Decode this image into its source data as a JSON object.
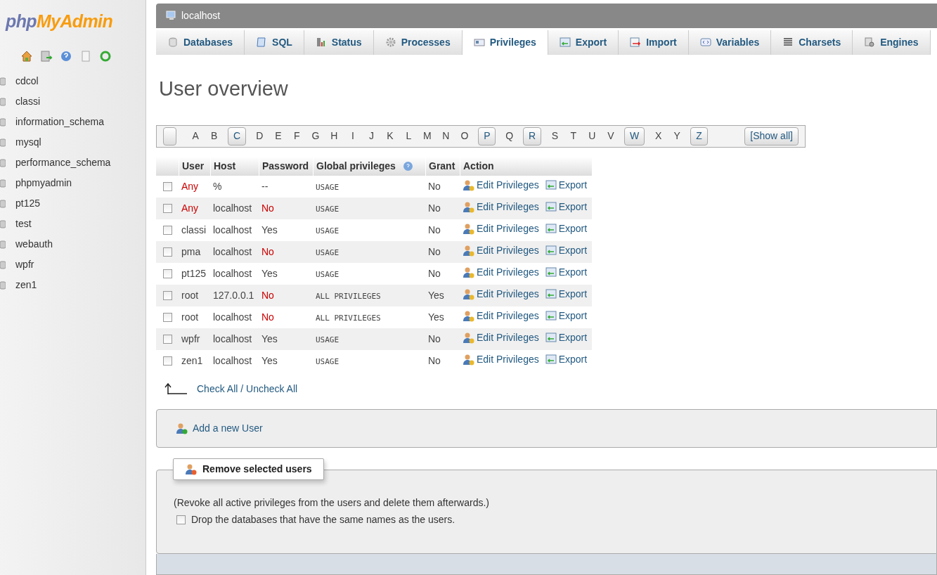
{
  "sidebar": {
    "logo_left": "php",
    "logo_right": "MyAdmin",
    "databases": [
      "cdcol",
      "classi",
      "information_schema",
      "mysql",
      "performance_schema",
      "phpmyadmin",
      "pt125",
      "test",
      "webauth",
      "wpfr",
      "zen1"
    ]
  },
  "server": {
    "title": "localhost"
  },
  "tabs": [
    {
      "label": "Databases",
      "selected": false
    },
    {
      "label": "SQL",
      "selected": false
    },
    {
      "label": "Status",
      "selected": false
    },
    {
      "label": "Processes",
      "selected": false
    },
    {
      "label": "Privileges",
      "selected": true
    },
    {
      "label": "Export",
      "selected": false
    },
    {
      "label": "Import",
      "selected": false
    },
    {
      "label": "Variables",
      "selected": false
    },
    {
      "label": "Charsets",
      "selected": false
    },
    {
      "label": "Engines",
      "selected": false
    }
  ],
  "heading": "User overview",
  "letters": [
    {
      "label": "A",
      "enabled": false
    },
    {
      "label": "B",
      "enabled": false
    },
    {
      "label": "C",
      "enabled": true
    },
    {
      "label": "D",
      "enabled": false
    },
    {
      "label": "E",
      "enabled": false
    },
    {
      "label": "F",
      "enabled": false
    },
    {
      "label": "G",
      "enabled": false
    },
    {
      "label": "H",
      "enabled": false
    },
    {
      "label": "I",
      "enabled": false
    },
    {
      "label": "J",
      "enabled": false
    },
    {
      "label": "K",
      "enabled": false
    },
    {
      "label": "L",
      "enabled": false
    },
    {
      "label": "M",
      "enabled": false
    },
    {
      "label": "N",
      "enabled": false
    },
    {
      "label": "O",
      "enabled": false
    },
    {
      "label": "P",
      "enabled": true
    },
    {
      "label": "Q",
      "enabled": false
    },
    {
      "label": "R",
      "enabled": true
    },
    {
      "label": "S",
      "enabled": false
    },
    {
      "label": "T",
      "enabled": false
    },
    {
      "label": "U",
      "enabled": false
    },
    {
      "label": "V",
      "enabled": false
    },
    {
      "label": "W",
      "enabled": true
    },
    {
      "label": "X",
      "enabled": false
    },
    {
      "label": "Y",
      "enabled": false
    },
    {
      "label": "Z",
      "enabled": true
    }
  ],
  "show_all": "[Show all]",
  "table": {
    "columns": [
      "User",
      "Host",
      "Password",
      "Global privileges",
      "Grant",
      "Action"
    ],
    "rows": [
      {
        "user": "Any",
        "anonymous": true,
        "host": "%",
        "password": "--",
        "password_warning": false,
        "privileges": "USAGE",
        "grant": "No",
        "checked": false,
        "edit": "Edit Privileges",
        "export": "Export"
      },
      {
        "user": "Any",
        "anonymous": true,
        "host": "localhost",
        "password": "No",
        "password_warning": true,
        "privileges": "USAGE",
        "grant": "No",
        "checked": false,
        "edit": "Edit Privileges",
        "export": "Export"
      },
      {
        "user": "classi",
        "anonymous": false,
        "host": "localhost",
        "password": "Yes",
        "password_warning": false,
        "privileges": "USAGE",
        "grant": "No",
        "checked": false,
        "edit": "Edit Privileges",
        "export": "Export"
      },
      {
        "user": "pma",
        "anonymous": false,
        "host": "localhost",
        "password": "No",
        "password_warning": true,
        "privileges": "USAGE",
        "grant": "No",
        "checked": false,
        "edit": "Edit Privileges",
        "export": "Export"
      },
      {
        "user": "pt125",
        "anonymous": false,
        "host": "localhost",
        "password": "Yes",
        "password_warning": false,
        "privileges": "USAGE",
        "grant": "No",
        "checked": false,
        "edit": "Edit Privileges",
        "export": "Export"
      },
      {
        "user": "root",
        "anonymous": false,
        "host": "127.0.0.1",
        "password": "No",
        "password_warning": true,
        "privileges": "ALL PRIVILEGES",
        "grant": "Yes",
        "checked": false,
        "edit": "Edit Privileges",
        "export": "Export"
      },
      {
        "user": "root",
        "anonymous": false,
        "host": "localhost",
        "password": "No",
        "password_warning": true,
        "privileges": "ALL PRIVILEGES",
        "grant": "Yes",
        "checked": false,
        "edit": "Edit Privileges",
        "export": "Export"
      },
      {
        "user": "wpfr",
        "anonymous": false,
        "host": "localhost",
        "password": "Yes",
        "password_warning": false,
        "privileges": "USAGE",
        "grant": "No",
        "checked": false,
        "edit": "Edit Privileges",
        "export": "Export"
      },
      {
        "user": "zen1",
        "anonymous": false,
        "host": "localhost",
        "password": "Yes",
        "password_warning": false,
        "privileges": "USAGE",
        "grant": "No",
        "checked": false,
        "edit": "Edit Privileges",
        "export": "Export"
      }
    ]
  },
  "check_all": "Check All / Uncheck All",
  "add_user": "Add a new User",
  "remove": {
    "legend": "Remove selected users",
    "note": "(Revoke all active privileges from the users and delete them afterwards.)",
    "drop_label": "Drop the databases that have the same names as the users.",
    "drop_checked": false
  }
}
